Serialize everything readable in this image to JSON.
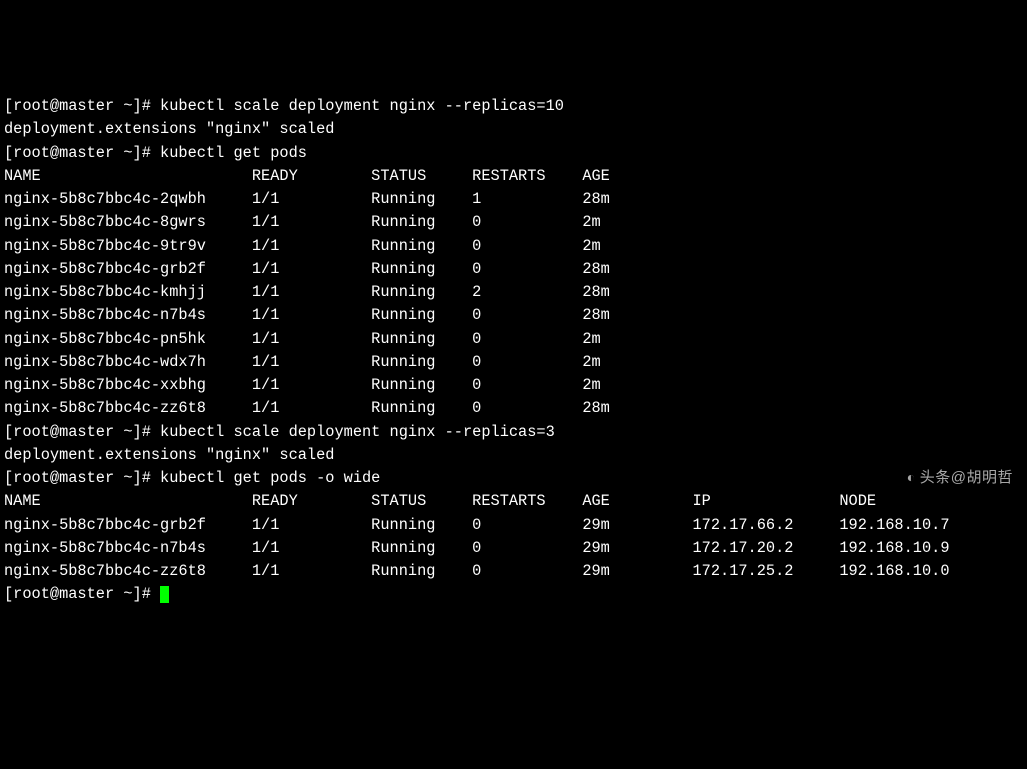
{
  "prompt_user": "root",
  "prompt_host": "master",
  "prompt_path": "~",
  "commands": {
    "scale10": "kubectl scale deployment nginx --replicas=10",
    "scale10_output": "deployment.extensions \"nginx\" scaled",
    "getpods": "kubectl get pods",
    "scale3": "kubectl scale deployment nginx --replicas=3",
    "scale3_output": "deployment.extensions \"nginx\" scaled",
    "getpods_wide": "kubectl get pods -o wide"
  },
  "table1_headers": {
    "name": "NAME",
    "ready": "READY",
    "status": "STATUS",
    "restarts": "RESTARTS",
    "age": "AGE"
  },
  "table1_rows": [
    {
      "name": "nginx-5b8c7bbc4c-2qwbh",
      "ready": "1/1",
      "status": "Running",
      "restarts": "1",
      "age": "28m"
    },
    {
      "name": "nginx-5b8c7bbc4c-8gwrs",
      "ready": "1/1",
      "status": "Running",
      "restarts": "0",
      "age": "2m"
    },
    {
      "name": "nginx-5b8c7bbc4c-9tr9v",
      "ready": "1/1",
      "status": "Running",
      "restarts": "0",
      "age": "2m"
    },
    {
      "name": "nginx-5b8c7bbc4c-grb2f",
      "ready": "1/1",
      "status": "Running",
      "restarts": "0",
      "age": "28m"
    },
    {
      "name": "nginx-5b8c7bbc4c-kmhjj",
      "ready": "1/1",
      "status": "Running",
      "restarts": "2",
      "age": "28m"
    },
    {
      "name": "nginx-5b8c7bbc4c-n7b4s",
      "ready": "1/1",
      "status": "Running",
      "restarts": "0",
      "age": "28m"
    },
    {
      "name": "nginx-5b8c7bbc4c-pn5hk",
      "ready": "1/1",
      "status": "Running",
      "restarts": "0",
      "age": "2m"
    },
    {
      "name": "nginx-5b8c7bbc4c-wdx7h",
      "ready": "1/1",
      "status": "Running",
      "restarts": "0",
      "age": "2m"
    },
    {
      "name": "nginx-5b8c7bbc4c-xxbhg",
      "ready": "1/1",
      "status": "Running",
      "restarts": "0",
      "age": "2m"
    },
    {
      "name": "nginx-5b8c7bbc4c-zz6t8",
      "ready": "1/1",
      "status": "Running",
      "restarts": "0",
      "age": "28m"
    }
  ],
  "table2_headers": {
    "name": "NAME",
    "ready": "READY",
    "status": "STATUS",
    "restarts": "RESTARTS",
    "age": "AGE",
    "ip": "IP",
    "node": "NODE"
  },
  "table2_rows": [
    {
      "name": "nginx-5b8c7bbc4c-grb2f",
      "ready": "1/1",
      "status": "Running",
      "restarts": "0",
      "age": "29m",
      "ip": "172.17.66.2",
      "node": "192.168.10.7"
    },
    {
      "name": "nginx-5b8c7bbc4c-n7b4s",
      "ready": "1/1",
      "status": "Running",
      "restarts": "0",
      "age": "29m",
      "ip": "172.17.20.2",
      "node": "192.168.10.9"
    },
    {
      "name": "nginx-5b8c7bbc4c-zz6t8",
      "ready": "1/1",
      "status": "Running",
      "restarts": "0",
      "age": "29m",
      "ip": "172.17.25.2",
      "node": "192.168.10.0"
    }
  ],
  "watermark": "头条@胡明哲"
}
